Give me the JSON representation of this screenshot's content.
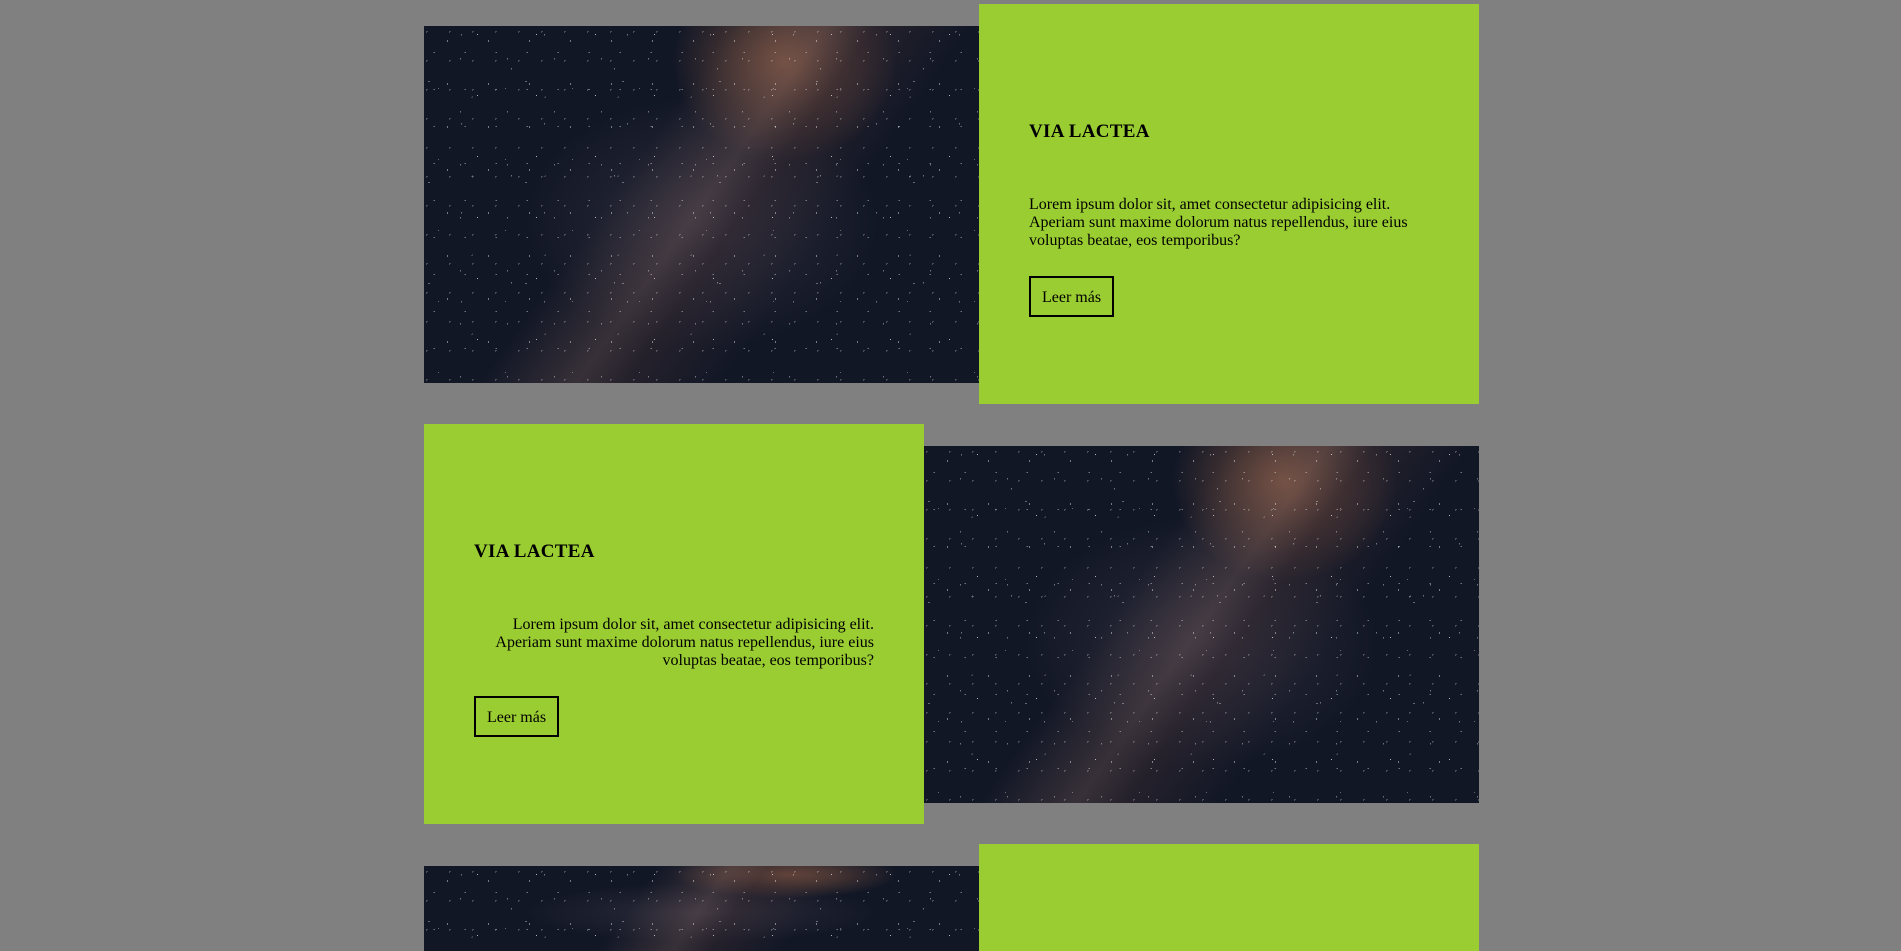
{
  "sections": [
    {
      "title": "VIA LACTEA",
      "text": "Lorem ipsum dolor sit, amet consectetur adipisicing elit. Aperiam sunt maxime dolorum natus repellendus, iure eius voluptas beatae, eos temporibus?",
      "button_label": "Leer más"
    },
    {
      "title": "VIA LACTEA",
      "text": "Lorem ipsum dolor sit, amet consectetur adipisicing elit. Aperiam sunt maxime dolorum natus repellendus, iure eius voluptas beatae, eos temporibus?",
      "button_label": "Leer más"
    }
  ],
  "colors": {
    "page_background": "#808080",
    "card_background": "#9acd32"
  }
}
